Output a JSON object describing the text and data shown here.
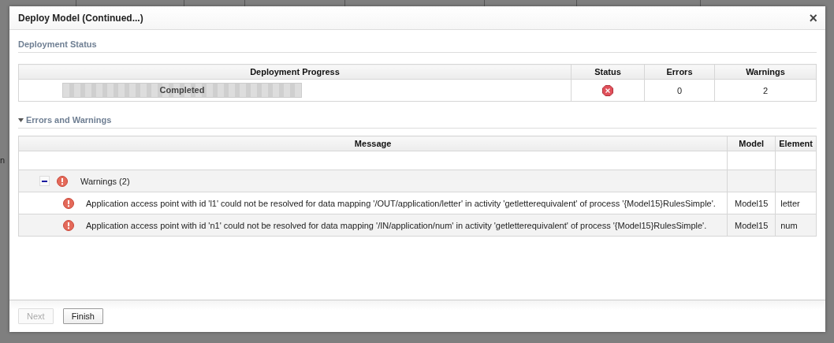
{
  "background": {
    "side_fragments": [
      "n"
    ]
  },
  "dialog": {
    "title": "Deploy Model (Continued...)",
    "close": "×",
    "deployment_status": {
      "heading": "Deployment Status",
      "columns": [
        "Deployment Progress",
        "Status",
        "Errors",
        "Warnings"
      ],
      "row": {
        "progress_label": "Completed",
        "level": 1,
        "status_ok": false,
        "errors": "0",
        "warnings": "2"
      }
    },
    "errors_and_warnings": {
      "heading": "Errors and Warnings",
      "expanded": true,
      "columns": [
        "Message",
        "Model",
        "Element"
      ],
      "groups": [
        {
          "label": "Warnings (2)",
          "kind": "warning",
          "expanded": true,
          "children": [
            {
              "message": "Application access point with id 'l1' could not be resolved for data mapping '/OUT/application/letter' in activity 'getletterequivalent' of process '{Model15}RulesSimple'.",
              "kind": "warning",
              "model": "Model15",
              "element": "letter"
            },
            {
              "message": "Application access point with id 'n1' could not be resolved for data mapping '/IN/application/num' in activity 'getletterequivalent' of process '{Model15}RulesSimple'.",
              "kind": "warning",
              "model": "Model15",
              "element": "num"
            }
          ]
        }
      ]
    },
    "buttons": [
      {
        "label": "Next",
        "disabled": true
      },
      {
        "label": "Finish",
        "disabled": false
      }
    ]
  }
}
